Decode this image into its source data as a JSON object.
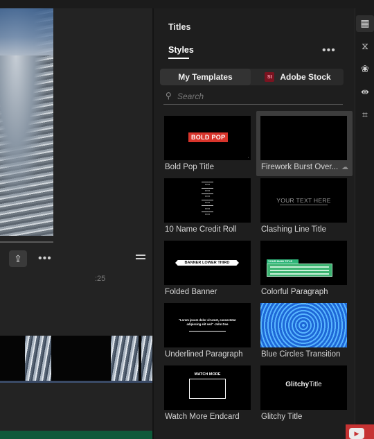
{
  "panel": {
    "tab_titles": "Titles",
    "tab_styles": "Styles",
    "more": "•••",
    "segments": {
      "my_templates": "My Templates",
      "adobe_stock": "Adobe Stock",
      "stock_badge": "St"
    },
    "search_placeholder": "Search"
  },
  "monitor": {
    "timecode": ":25",
    "more": "•••"
  },
  "templates": [
    {
      "label": "Bold Pop Title",
      "thumb_text": "BOLD POP"
    },
    {
      "label": "Firework Burst Over...",
      "thumb_text": ""
    },
    {
      "label": "10 Name Credit Roll",
      "thumb_text": ""
    },
    {
      "label": "Clashing Line Title",
      "thumb_text": "YOUR TEXT HERE"
    },
    {
      "label": "Folded Banner",
      "thumb_text": "BANNER LOWER THIRD"
    },
    {
      "label": "Colorful Paragraph",
      "thumb_text": "YOUR MAIN TITLE"
    },
    {
      "label": "Underlined Paragraph",
      "thumb_text": "\"Lorem ipsum dolor sit amet, consectetur adipiscing elit sed\" -John Doe"
    },
    {
      "label": "Blue Circles Transition",
      "thumb_text": ""
    },
    {
      "label": "Watch More Endcard",
      "thumb_text": "WATCH MORE"
    },
    {
      "label": "Glitchy Title",
      "thumb_text_bold": "Glitchy",
      "thumb_text_rest": "Title"
    }
  ],
  "icons": {
    "search": "search-icon",
    "share": "share-icon",
    "hamburger": "hamburger-icon",
    "cloud": "cloud-download-icon",
    "toolbar": [
      "titles-icon",
      "transitions-icon",
      "color-icon",
      "effects-icon",
      "crop-icon"
    ],
    "youtube": "youtube-icon"
  },
  "colors": {
    "accent_red": "#d8342b",
    "stock_badge": "#7a1320",
    "panel_bg": "#1e1e1e"
  }
}
